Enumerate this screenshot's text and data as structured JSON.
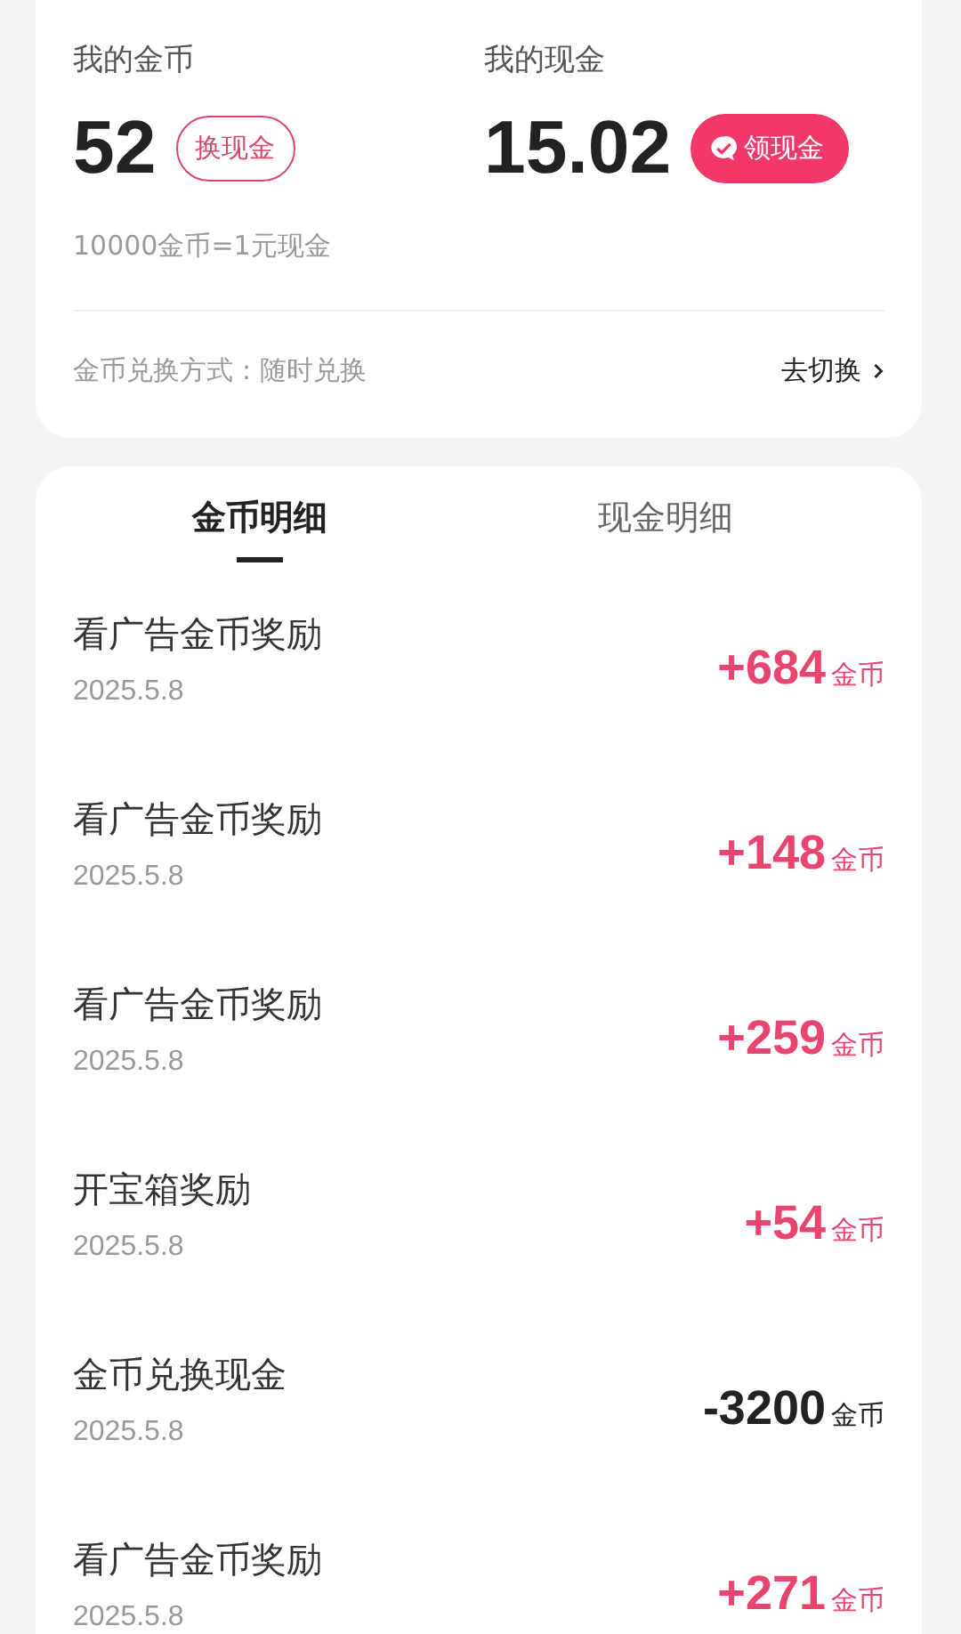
{
  "summary": {
    "coins": {
      "label": "我的金币",
      "value": "52",
      "button": "换现金"
    },
    "cash": {
      "label": "我的现金",
      "value": "15.02",
      "button": "领现金"
    },
    "rate": "10000金币=1元现金",
    "method": "金币兑换方式：随时兑换",
    "switch": "去切换"
  },
  "tabs": [
    {
      "label": "金币明细",
      "selected": true
    },
    {
      "label": "现金明细",
      "selected": false
    }
  ],
  "records": [
    {
      "title": "看广告金币奖励",
      "date": "2025.5.8",
      "amount": "+684",
      "unit": "金币",
      "kind": "gain"
    },
    {
      "title": "看广告金币奖励",
      "date": "2025.5.8",
      "amount": "+148",
      "unit": "金币",
      "kind": "gain"
    },
    {
      "title": "看广告金币奖励",
      "date": "2025.5.8",
      "amount": "+259",
      "unit": "金币",
      "kind": "gain"
    },
    {
      "title": "开宝箱奖励",
      "date": "2025.5.8",
      "amount": "+54",
      "unit": "金币",
      "kind": "gain"
    },
    {
      "title": "金币兑换现金",
      "date": "2025.5.8",
      "amount": "-3200",
      "unit": "金币",
      "kind": "spend"
    },
    {
      "title": "看广告金币奖励",
      "date": "2025.5.8",
      "amount": "+271",
      "unit": "金币",
      "kind": "gain"
    }
  ]
}
